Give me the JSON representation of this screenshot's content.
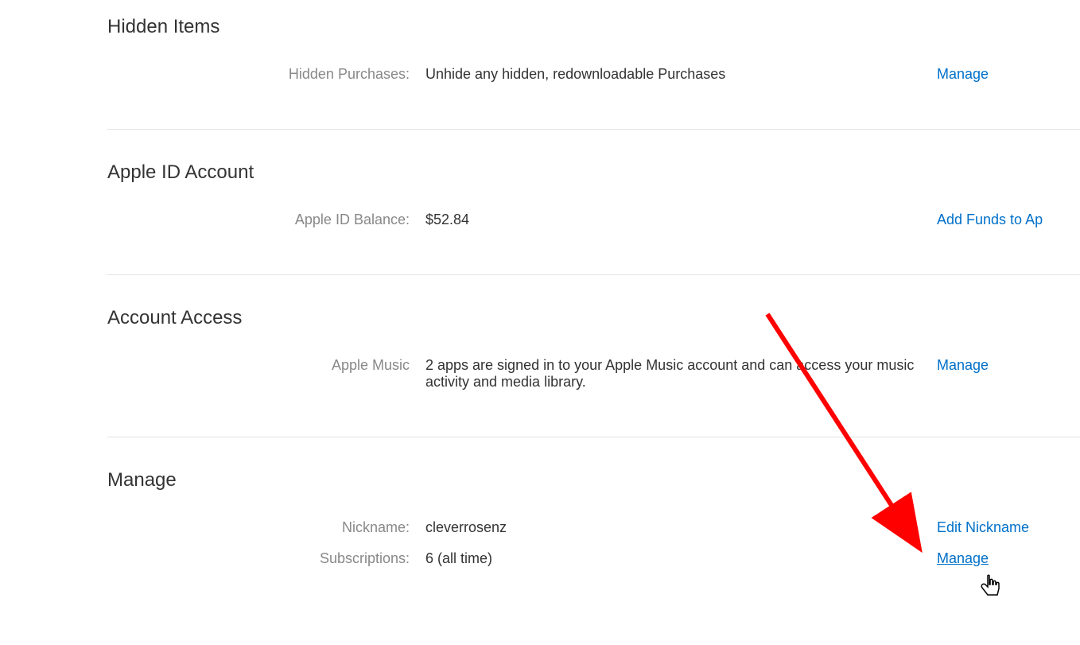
{
  "sections": {
    "hidden_items": {
      "title": "Hidden Items",
      "rows": {
        "hidden_purchases": {
          "label": "Hidden Purchases:",
          "value": "Unhide any hidden, redownloadable Purchases",
          "action": "Manage"
        }
      }
    },
    "apple_id_account": {
      "title": "Apple ID Account",
      "rows": {
        "balance": {
          "label": "Apple ID Balance:",
          "value": "$52.84",
          "action": "Add Funds to Ap"
        }
      }
    },
    "account_access": {
      "title": "Account Access",
      "rows": {
        "apple_music": {
          "label": "Apple Music",
          "value": "2 apps are signed in to your Apple Music account and can access your music activity and media library.",
          "action": "Manage"
        }
      }
    },
    "manage": {
      "title": "Manage",
      "rows": {
        "nickname": {
          "label": "Nickname:",
          "value": "cleverrosenz",
          "action": "Edit Nickname"
        },
        "subscriptions": {
          "label": "Subscriptions:",
          "value": "6 (all time)",
          "action": "Manage"
        }
      }
    }
  }
}
